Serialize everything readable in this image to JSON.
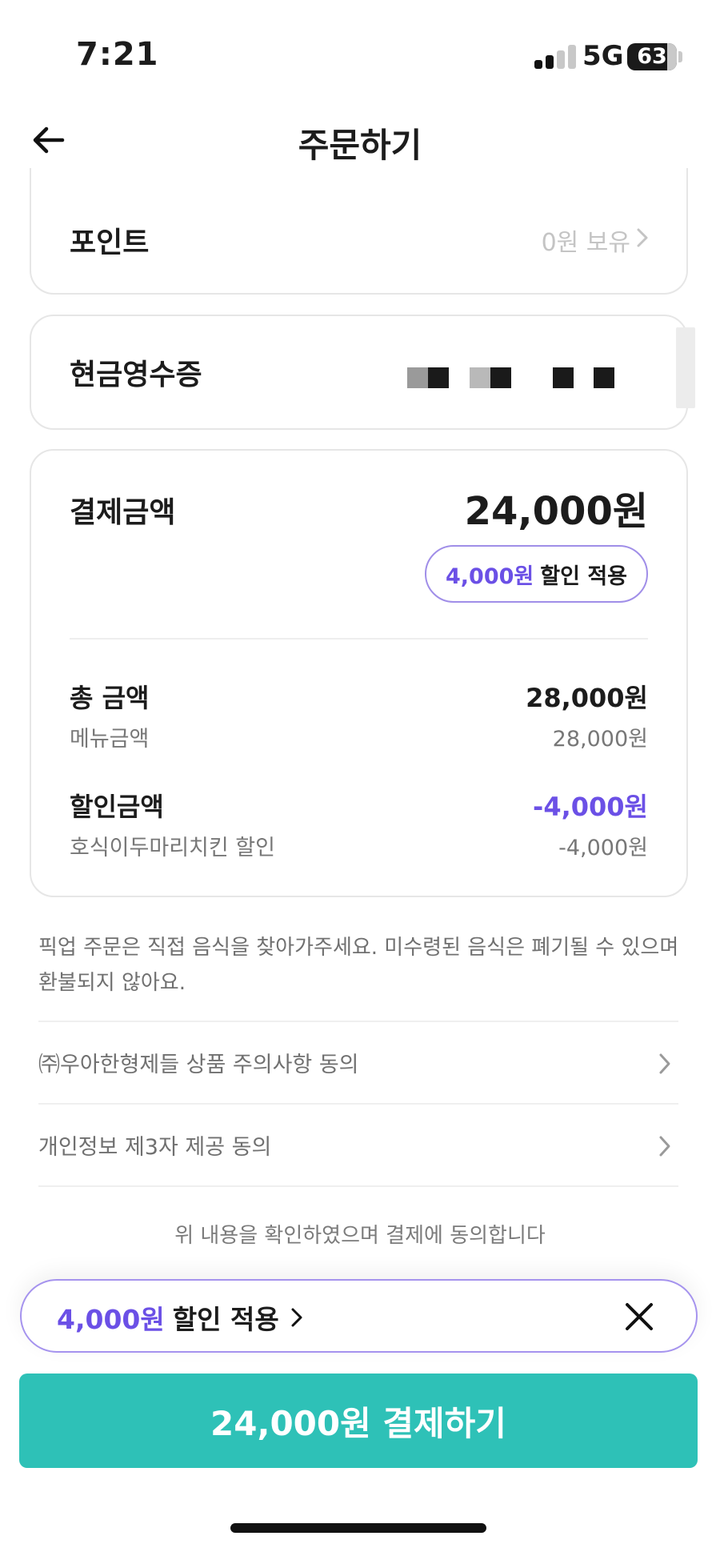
{
  "status_bar": {
    "time": "7:21",
    "network": "5G",
    "battery": "63",
    "battery_level_percent": 63
  },
  "header": {
    "title": "주문하기",
    "back_icon": "arrow-left-icon"
  },
  "points": {
    "label": "포인트",
    "value": "0원 보유"
  },
  "cash_receipt": {
    "label": "현금영수증"
  },
  "payment": {
    "label": "결제금액",
    "total": "24,000원",
    "discount_chip": {
      "amount": "4,000원",
      "text": "할인 적용"
    },
    "lines": [
      {
        "label": "총 금액",
        "value": "28,000원",
        "sub_label": "메뉴금액",
        "sub_value": "28,000원"
      },
      {
        "label": "할인금액",
        "value": "-4,000원",
        "sub_label": "호식이두마리치킨 할인",
        "sub_value": "-4,000원"
      }
    ]
  },
  "notice": "픽업 주문은 직접 음식을 찾아가주세요. 미수령된 음식은 폐기될 수 있으며 환불되지 않아요.",
  "agreements": [
    {
      "label": "㈜우아한형제들 상품 주의사항 동의"
    },
    {
      "label": "개인정보 제3자 제공 동의"
    }
  ],
  "confirm_text": "위 내용을 확인하였으며 결제에 동의합니다",
  "discount_bar": {
    "amount": "4,000원",
    "text": "할인 적용"
  },
  "pay_button": {
    "label": "24,000원 결제하기"
  },
  "colors": {
    "accent": "#6b50e6",
    "primary_button": "#2ec1b7",
    "chip_border": "#a08ee8"
  }
}
